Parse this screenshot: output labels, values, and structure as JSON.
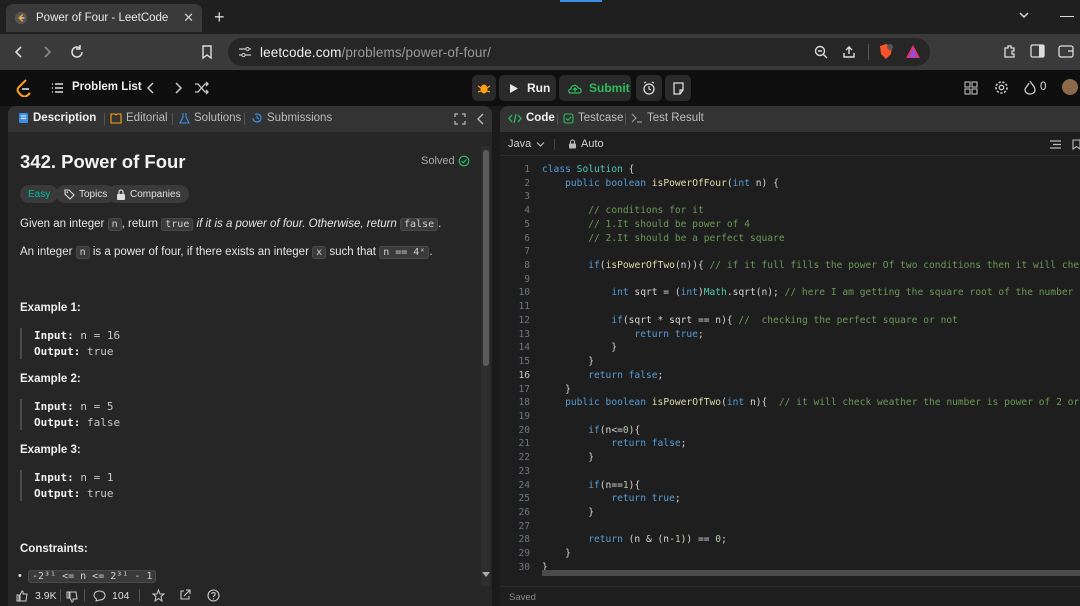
{
  "browser": {
    "tab_title": "Power of Four - LeetCode",
    "url_domain": "leetcode.com",
    "url_path": "/problems/power-of-four/"
  },
  "header": {
    "problem_list": "Problem List",
    "run": "Run",
    "submit": "Submit",
    "fire_count": "0"
  },
  "left_tabs": [
    "Description",
    "Editorial",
    "Solutions",
    "Submissions"
  ],
  "problem": {
    "title": "342. Power of Four",
    "solved": "Solved",
    "difficulty": "Easy",
    "topics": "Topics",
    "companies": "Companies",
    "desc1_a": "Given an integer ",
    "desc1_n": "n",
    "desc1_b": ", return ",
    "desc1_true": "true",
    "desc1_c": " if it is a power of four. Otherwise, return ",
    "desc1_false": "false",
    "desc1_d": ".",
    "desc2_a": "An integer ",
    "desc2_n": "n",
    "desc2_b": " is a power of four, if there exists an integer ",
    "desc2_x": "x",
    "desc2_c": " such that ",
    "desc2_eq": "n == 4ˣ",
    "desc2_d": ".",
    "examples": [
      {
        "title": "Example 1:",
        "input_label": "Input:",
        "input": " n = 16",
        "output_label": "Output:",
        "output": " true"
      },
      {
        "title": "Example 2:",
        "input_label": "Input:",
        "input": " n = 5",
        "output_label": "Output:",
        "output": " false"
      },
      {
        "title": "Example 3:",
        "input_label": "Input:",
        "input": " n = 1",
        "output_label": "Output:",
        "output": " true"
      }
    ],
    "constraints_title": "Constraints:",
    "constraint": "-2³¹ <= n <= 2³¹ - 1",
    "likes": "3.9K",
    "comments": "104"
  },
  "right_tabs": [
    "Code",
    "Testcase",
    "Test Result"
  ],
  "editor": {
    "language": "Java",
    "mode": "Auto",
    "status": "Saved"
  },
  "code_lines": [
    "class Solution {",
    "    public boolean isPowerOfFour(int n) {",
    "",
    "        // conditions for it",
    "        // 1.It should be power of 4",
    "        // 2.It should be a perfect square",
    "",
    "        if(isPowerOfTwo(n)){ // if it full fills the power Of two conditions then it will check pe",
    "",
    "            int sqrt = (int)Math.sqrt(n); // here I am getting the square root of the number n",
    "",
    "            if(sqrt * sqrt == n){ //  checking the perfect square or not",
    "                return true;",
    "            }",
    "        }",
    "        return false;",
    "    }",
    "    public boolean isPowerOfTwo(int n){  // it will check weather the number is power of 2 or not",
    "",
    "        if(n<=0){",
    "            return false;",
    "        }",
    "",
    "        if(n==1){",
    "            return true;",
    "        }",
    "",
    "        return (n & (n-1)) == 0;",
    "    }",
    "}"
  ]
}
